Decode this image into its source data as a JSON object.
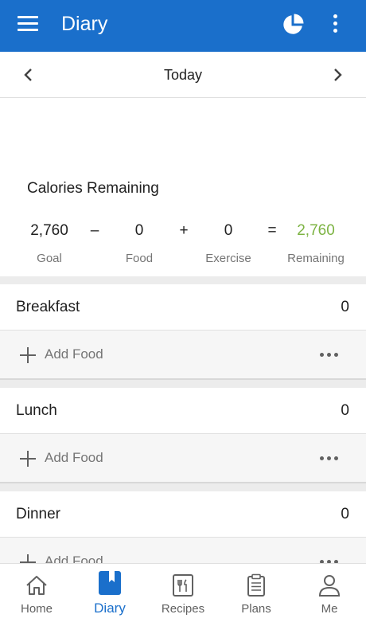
{
  "appbar": {
    "title": "Diary",
    "menu_icon": "menu-icon",
    "chart_icon": "pie-chart-icon",
    "more_icon": "more-vert-icon"
  },
  "datebar": {
    "date": "Today"
  },
  "summary": {
    "heading": "Calories Remaining",
    "goal": "2,760",
    "goal_label": "Goal",
    "minus": "–",
    "food": "0",
    "food_label": "Food",
    "plus": "+",
    "exercise": "0",
    "exercise_label": "Exercise",
    "equals": "=",
    "remaining": "2,760",
    "remaining_label": "Remaining"
  },
  "meals": [
    {
      "name": "Breakfast",
      "calories": "0",
      "add_label": "Add Food"
    },
    {
      "name": "Lunch",
      "calories": "0",
      "add_label": "Add Food"
    },
    {
      "name": "Dinner",
      "calories": "0",
      "add_label": "Add Food"
    }
  ],
  "nav": [
    {
      "label": "Home",
      "icon": "home-icon",
      "active": false
    },
    {
      "label": "Diary",
      "icon": "diary-icon",
      "active": true
    },
    {
      "label": "Recipes",
      "icon": "recipes-icon",
      "active": false
    },
    {
      "label": "Plans",
      "icon": "plans-icon",
      "active": false
    },
    {
      "label": "Me",
      "icon": "person-icon",
      "active": false
    }
  ],
  "colors": {
    "brand": "#1a6fcb",
    "remaining": "#7cb342"
  }
}
